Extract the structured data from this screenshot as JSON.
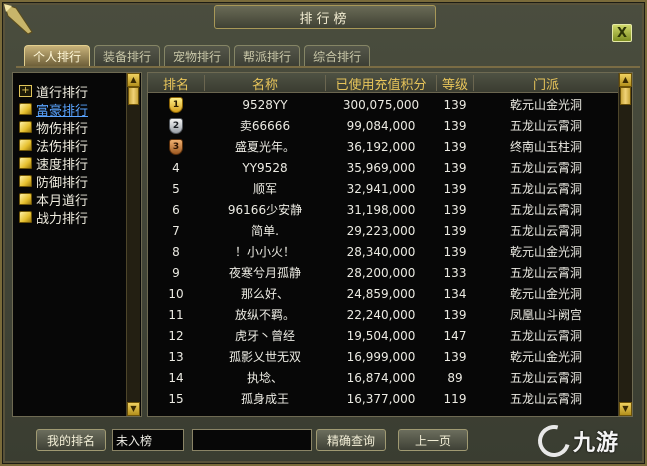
{
  "window": {
    "title": "排行榜",
    "close_label": "X"
  },
  "tabs": [
    {
      "label": "个人排行",
      "active": true
    },
    {
      "label": "装备排行",
      "active": false
    },
    {
      "label": "宠物排行",
      "active": false
    },
    {
      "label": "帮派排行",
      "active": false
    },
    {
      "label": "综合排行",
      "active": false
    }
  ],
  "sidebar": {
    "items": [
      {
        "label": "道行排行",
        "icon": "plus-box-icon",
        "selected": false
      },
      {
        "label": "富豪排行",
        "icon": "book-icon",
        "selected": true
      },
      {
        "label": "物伤排行",
        "icon": "book-icon",
        "selected": false
      },
      {
        "label": "法伤排行",
        "icon": "book-icon",
        "selected": false
      },
      {
        "label": "速度排行",
        "icon": "book-icon",
        "selected": false
      },
      {
        "label": "防御排行",
        "icon": "book-icon",
        "selected": false
      },
      {
        "label": "本月道行",
        "icon": "book-icon",
        "selected": false
      },
      {
        "label": "战力排行",
        "icon": "book-icon",
        "selected": false
      }
    ]
  },
  "table": {
    "headers": {
      "rank": "排名",
      "name": "名称",
      "score": "已使用充值积分",
      "level": "等级",
      "faction": "门派"
    },
    "rows": [
      {
        "rank": "1",
        "medal": "gold",
        "name": "9528YY",
        "score": "300,075,000",
        "level": "139",
        "faction": "乾元山金光洞"
      },
      {
        "rank": "2",
        "medal": "silver",
        "name": "卖66666",
        "score": "99,084,000",
        "level": "139",
        "faction": "五龙山云霄洞"
      },
      {
        "rank": "3",
        "medal": "bronze",
        "name": "盛夏光年。",
        "score": "36,192,000",
        "level": "139",
        "faction": "终南山玉柱洞"
      },
      {
        "rank": "4",
        "medal": "",
        "name": "YY9528",
        "score": "35,969,000",
        "level": "139",
        "faction": "五龙山云霄洞"
      },
      {
        "rank": "5",
        "medal": "",
        "name": "顺军",
        "score": "32,941,000",
        "level": "139",
        "faction": "五龙山云霄洞"
      },
      {
        "rank": "6",
        "medal": "",
        "name": "96166少安静",
        "score": "31,198,000",
        "level": "139",
        "faction": "五龙山云霄洞"
      },
      {
        "rank": "7",
        "medal": "",
        "name": "简单.",
        "score": "29,223,000",
        "level": "139",
        "faction": "五龙山云霄洞"
      },
      {
        "rank": "8",
        "medal": "",
        "name": "！小小火！",
        "score": "28,340,000",
        "level": "139",
        "faction": "乾元山金光洞"
      },
      {
        "rank": "9",
        "medal": "",
        "name": "夜寒兮月孤静",
        "score": "28,200,000",
        "level": "133",
        "faction": "五龙山云霄洞"
      },
      {
        "rank": "10",
        "medal": "",
        "name": "那么好、",
        "score": "24,859,000",
        "level": "134",
        "faction": "乾元山金光洞"
      },
      {
        "rank": "11",
        "medal": "",
        "name": "放纵不羁。",
        "score": "22,240,000",
        "level": "139",
        "faction": "凤凰山斗阙宫"
      },
      {
        "rank": "12",
        "medal": "",
        "name": "虎牙丶曾经",
        "score": "19,504,000",
        "level": "147",
        "faction": "五龙山云霄洞"
      },
      {
        "rank": "13",
        "medal": "",
        "name": "孤影乂世无双",
        "score": "16,999,000",
        "level": "139",
        "faction": "乾元山金光洞"
      },
      {
        "rank": "14",
        "medal": "",
        "name": "执埝、",
        "score": "16,874,000",
        "level": "89",
        "faction": "五龙山云霄洞"
      },
      {
        "rank": "15",
        "medal": "",
        "name": "孤身成王",
        "score": "16,377,000",
        "level": "119",
        "faction": "五龙山云霄洞"
      }
    ]
  },
  "footer": {
    "my_rank_button": "我的排名",
    "my_rank_value": "未入榜",
    "search_value": "",
    "search_button": "精确查询",
    "prev_button": "上一页"
  },
  "watermark": {
    "text": "九游"
  }
}
